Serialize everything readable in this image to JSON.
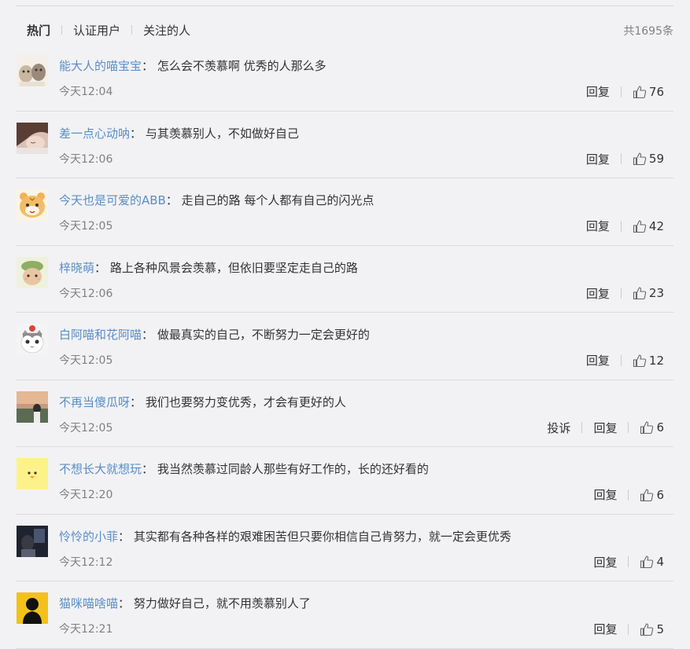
{
  "tabs": [
    {
      "label": "热门",
      "active": true
    },
    {
      "label": "认证用户",
      "active": false
    },
    {
      "label": "关注的人",
      "active": false
    }
  ],
  "total_count": "共1695条",
  "comments": [
    {
      "username": "能大人的喵宝宝",
      "text": "怎么会不羡慕啊 优秀的人那么多",
      "time": "今天12:04",
      "report": "",
      "reply": "回复",
      "likes": "76",
      "avatar": "cats-avatar"
    },
    {
      "username": "差一点心动呐",
      "text": "与其羡慕别人，不如做好自己",
      "time": "今天12:06",
      "report": "",
      "reply": "回复",
      "likes": "59",
      "avatar": "sleeping-girl-avatar"
    },
    {
      "username": "今天也是可爱的ABB",
      "text": "走自己的路 每个人都有自己的闪光点",
      "time": "今天12:05",
      "report": "",
      "reply": "回复",
      "likes": "42",
      "avatar": "tiger-avatar"
    },
    {
      "username": "梓晓萌",
      "text": "路上各种风景会羡慕，但依旧要坚定走自己的路",
      "time": "今天12:06",
      "report": "",
      "reply": "回复",
      "likes": "23",
      "avatar": "frog-hat-avatar"
    },
    {
      "username": "白阿喵和花阿喵",
      "text": "做最真实的自己，不断努力一定会更好的",
      "time": "今天12:05",
      "report": "",
      "reply": "回复",
      "likes": "12",
      "avatar": "white-cat-avatar"
    },
    {
      "username": "不再当傻瓜呀",
      "text": "我们也要努力变优秀，才会有更好的人",
      "time": "今天12:05",
      "report": "投诉",
      "reply": "回复",
      "likes": "6",
      "avatar": "sunset-avatar"
    },
    {
      "username": "不想长大就想玩",
      "text": "我当然羡慕过同龄人那些有好工作的，长的还好看的",
      "time": "今天12:20",
      "report": "",
      "reply": "回复",
      "likes": "6",
      "avatar": "duck-avatar"
    },
    {
      "username": "怜怜的小菲",
      "text": "其实都有各种各样的艰难困苦但只要你相信自己肯努力，就一定会更优秀",
      "time": "今天12:12",
      "report": "",
      "reply": "回复",
      "likes": "4",
      "avatar": "dark-photo-avatar"
    },
    {
      "username": "猫咪喵啥喵",
      "text": "努力做好自己，就不用羡慕别人了",
      "time": "今天12:21",
      "report": "",
      "reply": "回复",
      "likes": "5",
      "avatar": "silhouette-avatar"
    }
  ],
  "colors": {
    "username": "#5a8ec6",
    "muted": "#808080",
    "background": "#f2f2f5"
  }
}
